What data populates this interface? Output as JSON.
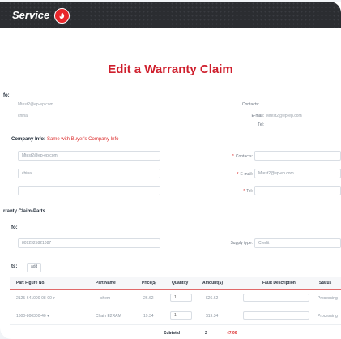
{
  "header": {
    "brand": "Service"
  },
  "page": {
    "title": "Edit a Warranty Claim"
  },
  "buyer_info": {
    "heading": "fo:",
    "email_text": "Mtest2@ep-ep.com",
    "company": "china",
    "contacts_label": "Contacts:",
    "email_label": "E-mail:",
    "email_value": "Mtest2@ep-ep.com",
    "tel_label": "Tel:"
  },
  "company_info": {
    "heading": "Company Info:",
    "same_link": "Same with Buyer's Company Info",
    "email_field": "Mtest2@ep-ep.com",
    "company_field": "china",
    "third_field": "",
    "contacts_label": "Contacts:",
    "email_label": "E-mail:",
    "email_value": "Mtest2@ep-ep.com",
    "tel_label": "Tel:"
  },
  "parts_section": {
    "heading": "rranty Claim-Parts",
    "info_heading": "fo:",
    "serial_field": "8092925821087",
    "supply_type_label": "Supply type:",
    "supply_type_value": "Credit",
    "parts_label": "ts:",
    "add_button": "add"
  },
  "table": {
    "headers": [
      "Part Figure No.",
      "Part Name",
      "Price($)",
      "Quantity",
      "Amount($)",
      "Fault Description",
      "Status"
    ],
    "rows": [
      {
        "figure_no": "2125-641000-08-00 ▾",
        "name": "chem",
        "price": "26.62",
        "qty": "1",
        "amount": "$26.62",
        "status": "Processing"
      },
      {
        "figure_no": "1600-800300-40 ▾",
        "name": "Chain E2RAM",
        "price": "19.34",
        "qty": "1",
        "amount": "$19.34",
        "status": "Processing"
      }
    ],
    "subtotal_label": "Subtotal",
    "subtotal_qty": "2",
    "subtotal_amount": "47.96"
  },
  "colors": {
    "accent": "#cf1f2d",
    "topbar": "#2b2d31"
  }
}
